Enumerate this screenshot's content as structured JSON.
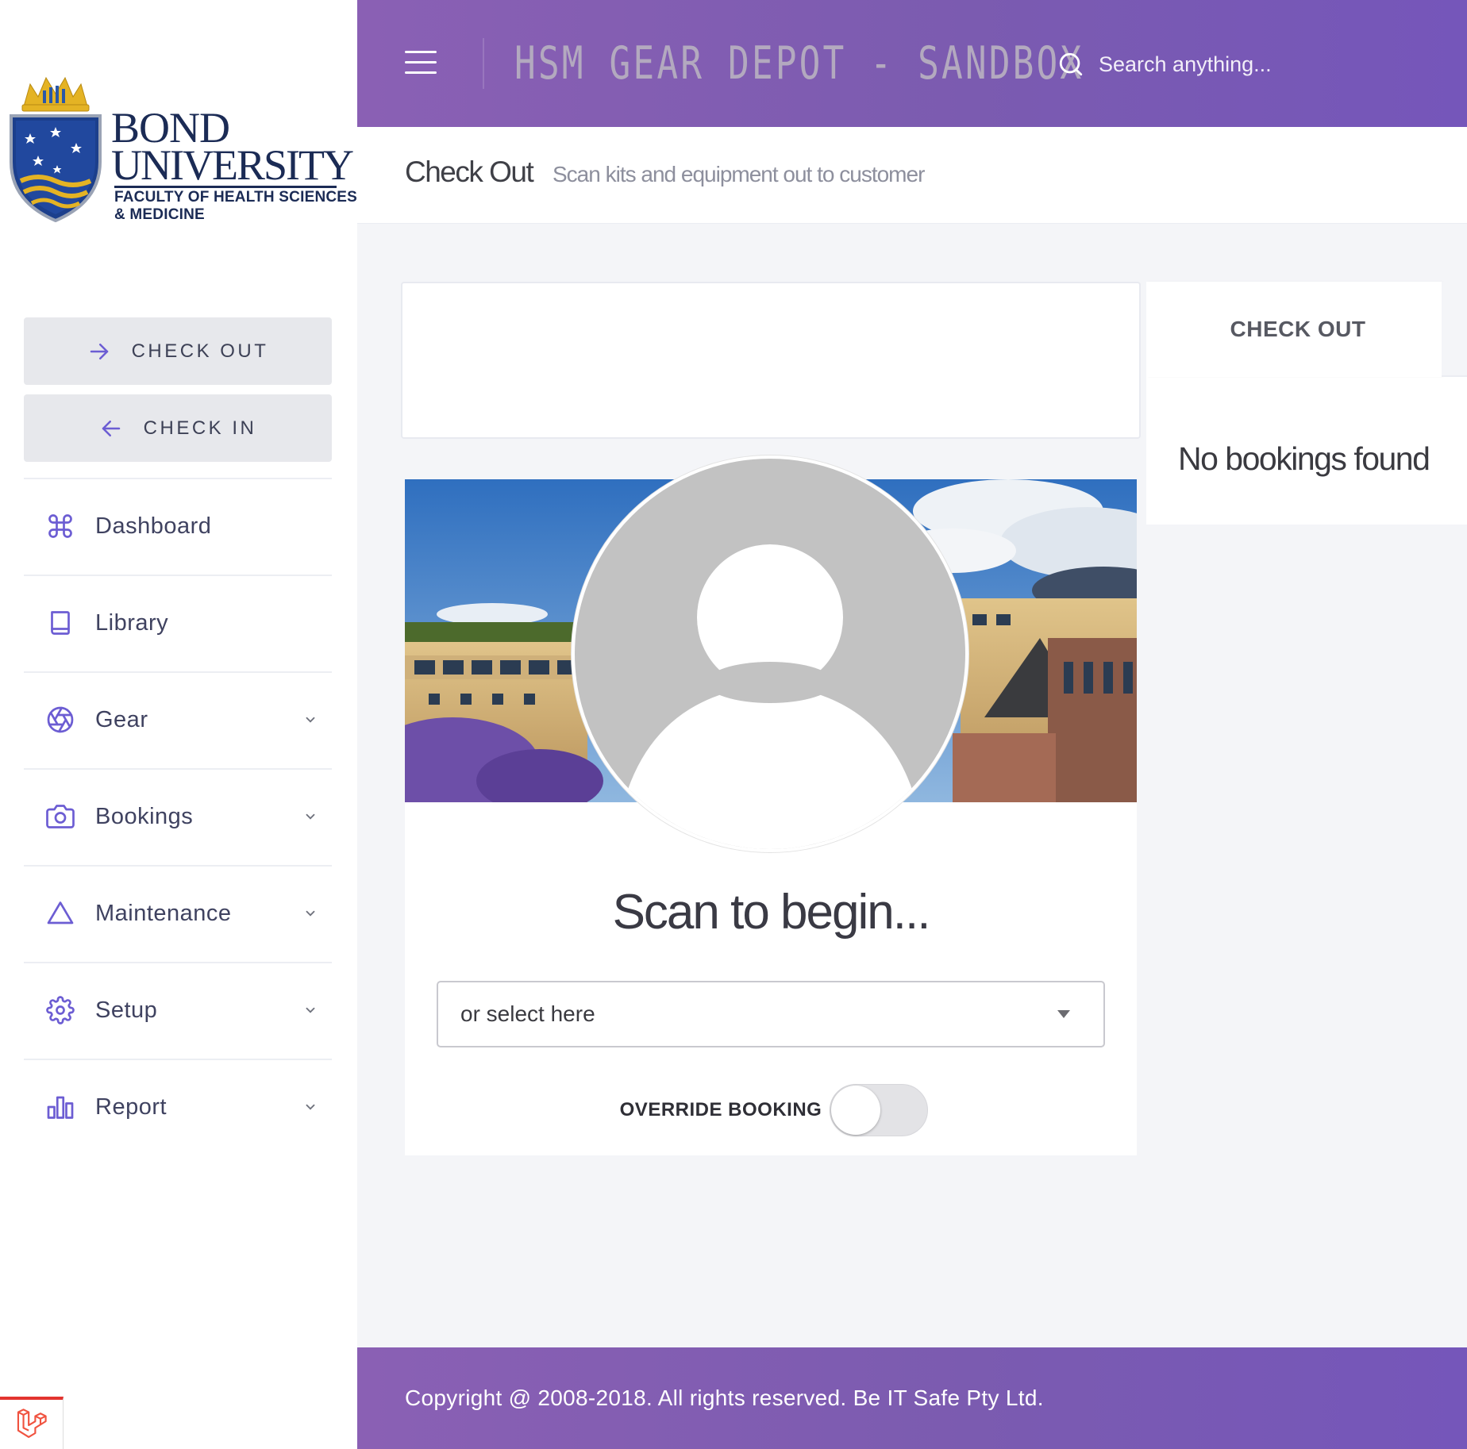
{
  "brand": {
    "logo_line1": "BOND",
    "logo_line2": "UNIVERSITY",
    "logo_line3": "FACULTY OF HEALTH SCIENCES",
    "logo_line4": "& MEDICINE",
    "colors": {
      "primary": "#7b5bb0",
      "navy": "#1b2b55",
      "gold": "#e4b324"
    }
  },
  "header": {
    "app_title": "HSM GEAR DEPOT - SANDBOX",
    "search_placeholder": "Search anything...",
    "menu_icon": "hamburger-icon",
    "search_icon": "search-icon"
  },
  "sidebar": {
    "checkout_button": "CHECK OUT",
    "checkin_button": "CHECK IN",
    "items": [
      {
        "label": "Dashboard",
        "icon": "command-icon",
        "has_children": false
      },
      {
        "label": "Library",
        "icon": "book-icon",
        "has_children": false
      },
      {
        "label": "Gear",
        "icon": "aperture-icon",
        "has_children": true
      },
      {
        "label": "Bookings",
        "icon": "camera-icon",
        "has_children": true
      },
      {
        "label": "Maintenance",
        "icon": "triangle-icon",
        "has_children": true
      },
      {
        "label": "Setup",
        "icon": "settings-icon",
        "has_children": true
      },
      {
        "label": "Report",
        "icon": "bar-chart-icon",
        "has_children": true
      }
    ]
  },
  "subheader": {
    "title": "Check Out",
    "subtitle": "Scan kits and equipment out to customer"
  },
  "main": {
    "scan_prompt": "Scan to begin...",
    "select_placeholder": "or select here",
    "override_label": "OVERRIDE BOOKING",
    "override_enabled": false
  },
  "bookings_panel": {
    "tab_label": "CHECK OUT",
    "empty_message": "No bookings found"
  },
  "footer": {
    "copyright": "Copyright @ 2008-2018. All rights reserved. Be IT Safe Pty Ltd."
  }
}
